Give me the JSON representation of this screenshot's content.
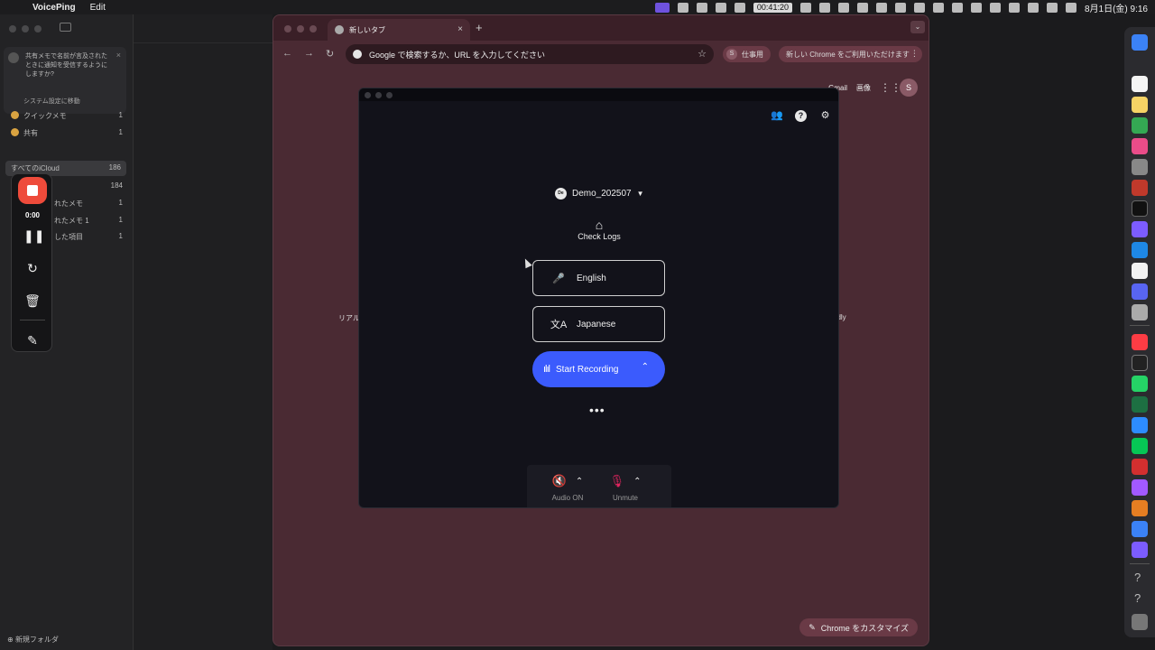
{
  "menubar": {
    "app_name": "VoicePing",
    "edit": "Edit",
    "timer": "00:41:20",
    "date_time": "8月1日(金) 9:16"
  },
  "notes": {
    "notice_message": "共有メモで名前が言及されたときに通知を受信するようにしますか?",
    "notice_link": "システム設定に移動",
    "rows": [
      {
        "label": "クイックメモ",
        "count": "1"
      },
      {
        "label": "共有",
        "count": "1"
      }
    ],
    "section_label": "iCloud",
    "icloud_rows": [
      {
        "label": "すべてのiCloud",
        "count": "186"
      },
      {
        "label": "",
        "count": "184"
      },
      {
        "label": "れたメモ",
        "count": "1"
      },
      {
        "label": "れたメモ 1",
        "count": "1"
      },
      {
        "label": "した項目",
        "count": "1"
      }
    ],
    "new_folder": "新規フォルダ"
  },
  "rec_widget": {
    "time": "0:00"
  },
  "chrome": {
    "tab_title": "新しいタブ",
    "omnibox_placeholder": "Google で検索するか、URL を入力してください",
    "profile_label": "仕事用",
    "profile_initial": "S",
    "update_label": "新しい Chrome をご利用いただけます",
    "gmail": "Gmail",
    "images": "画像",
    "account_initial": "S",
    "shortcut_left": "リアル",
    "shortcut_right": "ndly",
    "customize": "Chrome をカスタマイズ"
  },
  "voiceping": {
    "room_badge": "De",
    "room_name": "Demo_202507",
    "check_logs": "Check Logs",
    "speak_language": "English",
    "translate_language": "Japanese",
    "start_recording": "Start Recording",
    "audio_label": "Audio ON",
    "mic_label": "Unmute"
  },
  "colors": {
    "accent": "#3b5bfd",
    "record_red": "#ee4b3b",
    "muted_pink": "#e0245e",
    "chrome_theme": "#4a2a33"
  }
}
